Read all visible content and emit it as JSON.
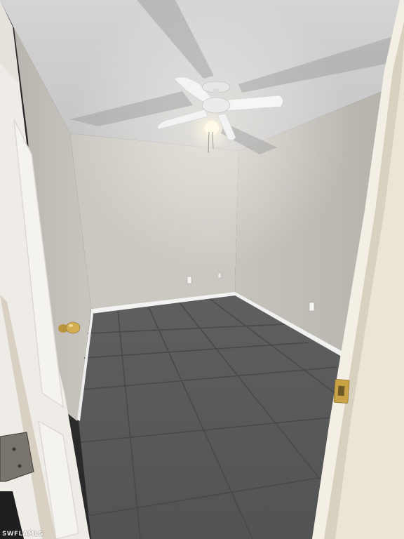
{
  "image": {
    "watermark_text": "SWFLAMLS",
    "colors": {
      "ceiling": "#d6d6d6",
      "left_wall": "#c7c3bd",
      "back_wall": "#cac6c0",
      "right_wall": "#c2beb8",
      "floor_tile": "#5a5b5d",
      "grout": "#4a4b4d",
      "baseboard": "#f4f4f2",
      "door": "#f2f0ec",
      "door_frame": "#e9e3d6",
      "hardware_brass": "#c9a447",
      "fan_blade": "#f5f5f5",
      "light_glow": "#fff8e0"
    }
  }
}
